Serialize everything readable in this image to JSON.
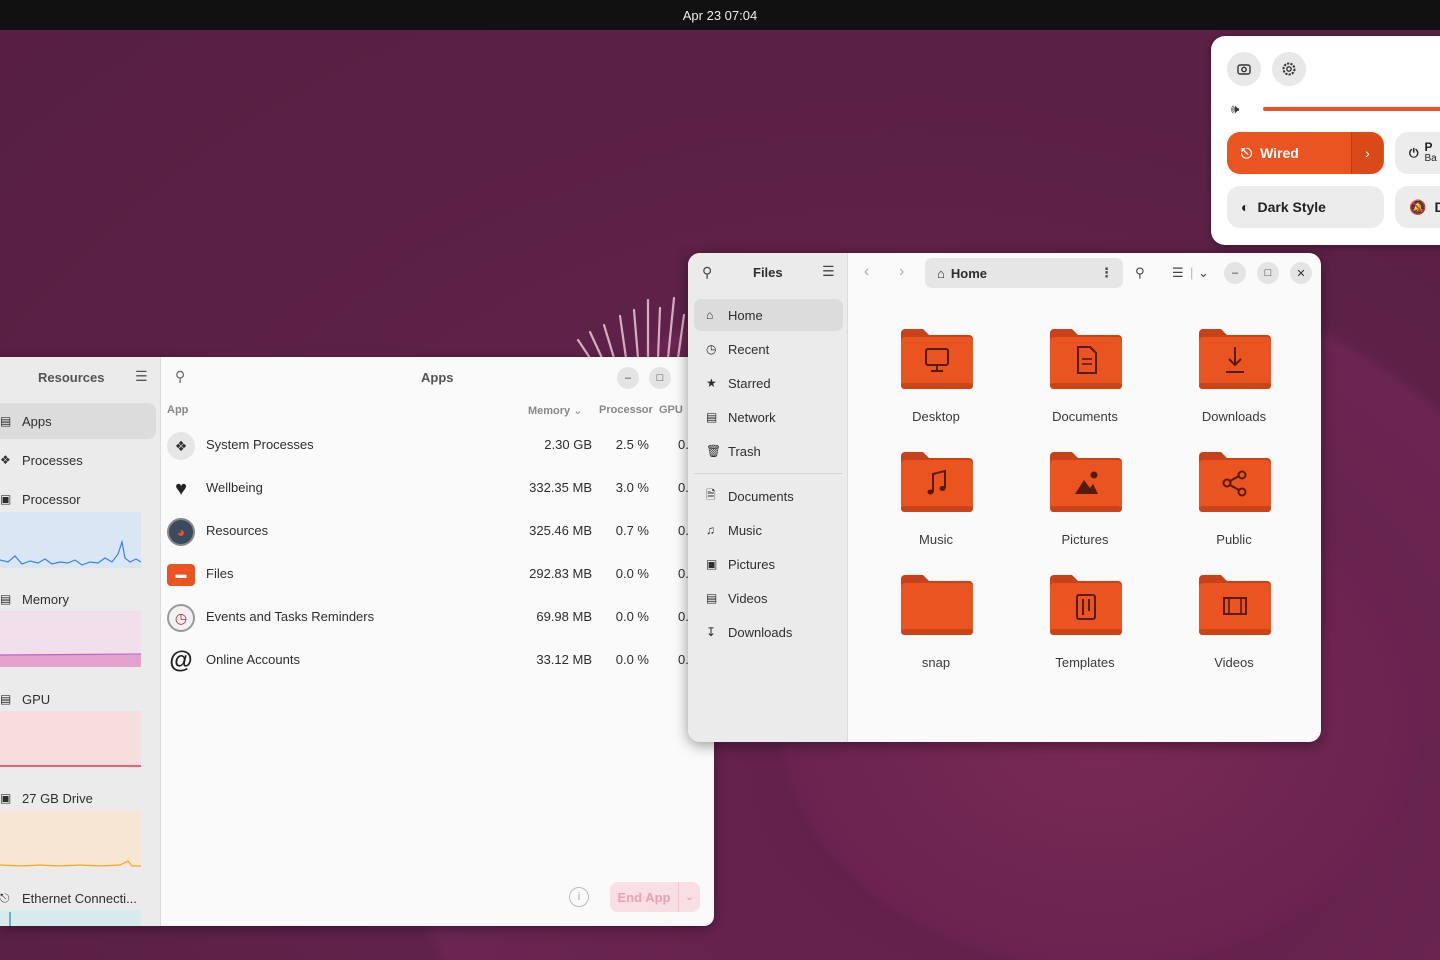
{
  "topbar": {
    "datetime": "Apr 23  07:04"
  },
  "quick_settings": {
    "wired_label": "Wired",
    "power_label": "P",
    "power_sub": "Ba",
    "dark_style_label": "Dark Style",
    "dnd_label": "D",
    "accent_color": "#e95420"
  },
  "resources": {
    "sidebar_title": "Resources",
    "title": "Apps",
    "nav": [
      {
        "label": "Apps"
      },
      {
        "label": "Processes"
      },
      {
        "label": "Processor"
      },
      {
        "label": "Memory"
      },
      {
        "label": "GPU"
      },
      {
        "label": "27 GB Drive"
      },
      {
        "label": "Ethernet Connecti..."
      }
    ],
    "columns": {
      "app": "App",
      "memory": "Memory",
      "processor": "Processor",
      "gpu": "GPU"
    },
    "apps": [
      {
        "name": "System Processes",
        "memory": "2.30 GB",
        "processor": "2.5 %",
        "gpu": "0."
      },
      {
        "name": "Wellbeing",
        "memory": "332.35 MB",
        "processor": "3.0 %",
        "gpu": "0."
      },
      {
        "name": "Resources",
        "memory": "325.46 MB",
        "processor": "0.7 %",
        "gpu": "0."
      },
      {
        "name": "Files",
        "memory": "292.83 MB",
        "processor": "0.0 %",
        "gpu": "0."
      },
      {
        "name": "Events and Tasks Reminders",
        "memory": "69.98 MB",
        "processor": "0.0 %",
        "gpu": "0."
      },
      {
        "name": "Online Accounts",
        "memory": "33.12 MB",
        "processor": "0.0 %",
        "gpu": "0."
      }
    ],
    "end_app_label": "End App"
  },
  "files": {
    "sidebar_title": "Files",
    "path_label": "Home",
    "nav": [
      {
        "label": "Home"
      },
      {
        "label": "Recent"
      },
      {
        "label": "Starred"
      },
      {
        "label": "Network"
      },
      {
        "label": "Trash"
      },
      {
        "label": "Documents"
      },
      {
        "label": "Music"
      },
      {
        "label": "Pictures"
      },
      {
        "label": "Videos"
      },
      {
        "label": "Downloads"
      }
    ],
    "folders": [
      {
        "label": "Desktop",
        "icon": "monitor-icon"
      },
      {
        "label": "Documents",
        "icon": "document-icon"
      },
      {
        "label": "Downloads",
        "icon": "download-icon"
      },
      {
        "label": "Music",
        "icon": "music-icon"
      },
      {
        "label": "Pictures",
        "icon": "picture-icon"
      },
      {
        "label": "Public",
        "icon": "share-icon"
      },
      {
        "label": "snap",
        "icon": "folder-icon"
      },
      {
        "label": "Templates",
        "icon": "template-icon"
      },
      {
        "label": "Videos",
        "icon": "film-icon"
      }
    ],
    "folder_color": "#e95420"
  }
}
